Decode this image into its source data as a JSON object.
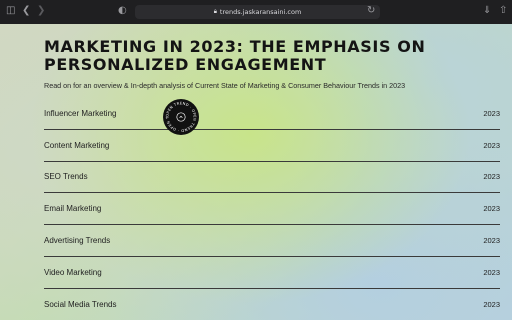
{
  "browser": {
    "url": "trends.jaskaransaini.com",
    "icons": [
      "sidebar-icon",
      "back-arrow-icon",
      "forward-arrow-icon",
      "shield-icon",
      "lock-icon",
      "reload-icon",
      "download-icon",
      "share-icon"
    ]
  },
  "page": {
    "headline_line1": "Marketing in 2023: The Emphasis on",
    "headline_line2": "Personalized Engagement",
    "subtitle": "Read on for an overview & In-depth analysis of Current State of Marketing & Consumer Behaviour Trends in 2023",
    "badge_text": "OPEN TREND · OPEN TREND · OPEN TREND ·",
    "items": [
      {
        "label": "Influencer Marketing",
        "year": "2023"
      },
      {
        "label": "Content Marketing",
        "year": "2023"
      },
      {
        "label": "SEO Trends",
        "year": "2023"
      },
      {
        "label": "Email Marketing",
        "year": "2023"
      },
      {
        "label": "Advertising Trends",
        "year": "2023"
      },
      {
        "label": "Video Marketing",
        "year": "2023"
      },
      {
        "label": "Social Media Trends",
        "year": "2023"
      }
    ]
  },
  "colors": {
    "accent_text": "#141414",
    "toolbar_bg": "#1f1f21",
    "badge_bg": "#111111"
  }
}
